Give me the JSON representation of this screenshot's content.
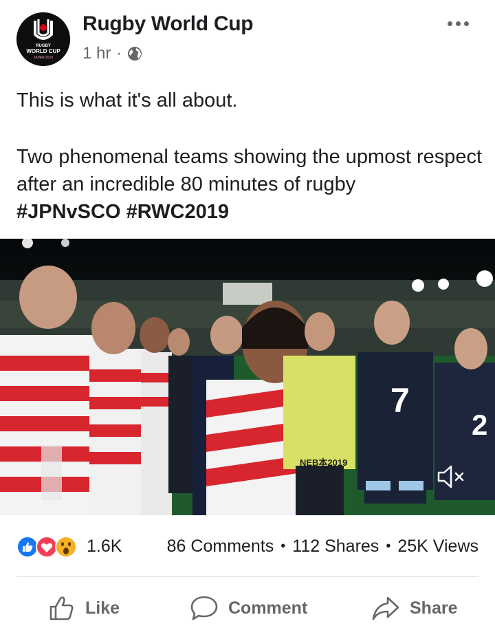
{
  "post": {
    "page_name": "Rugby World Cup",
    "time": "1 hr",
    "separator": "·",
    "privacy_icon": "globe-icon",
    "avatar_text": {
      "line1": "RUGBY",
      "line2": "WORLD CUP",
      "line3": "JAPAN 2019"
    },
    "text_line1": "This is what it's all about.",
    "text_line2": "Two phenomenal teams showing the upmost respect after an incredible 80 minutes of rugby",
    "hashtags": [
      "#JPNvSCO",
      "#RWC2019"
    ]
  },
  "video": {
    "muted_icon": "speaker-muted-icon",
    "jersey_numbers": [
      "7",
      "2"
    ],
    "board_text": "NEB本2019"
  },
  "stats": {
    "reaction_icons": [
      "like-icon",
      "love-icon",
      "wow-icon"
    ],
    "reaction_count": "1.6K",
    "comments": "86 Comments",
    "shares": "112 Shares",
    "views": "25K Views",
    "dot": "•"
  },
  "actions": {
    "like": "Like",
    "comment": "Comment",
    "share": "Share"
  },
  "colors": {
    "text": "#1c1e21",
    "secondary": "#65676b",
    "like_blue": "#1877f2",
    "love_red": "#f33e58",
    "wow_yellow": "#f7b125"
  }
}
